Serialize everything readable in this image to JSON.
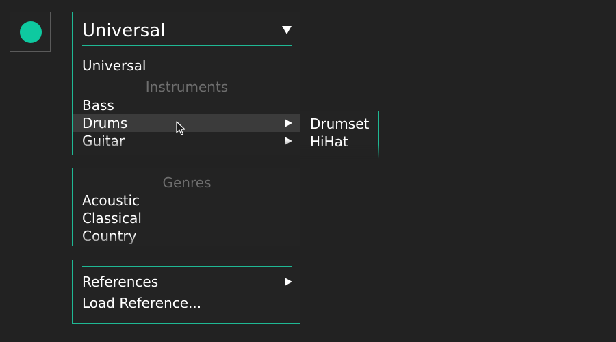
{
  "colors": {
    "background": "#222222",
    "accent": "#1fb894",
    "status_dot": "#0ec9a0",
    "section_label": "#6e6e6e",
    "highlight": "#3b3b3b"
  },
  "status": {
    "icon": "record-dot-icon"
  },
  "dropdown": {
    "selected": "Universal",
    "caret_icon": "triangle-down-icon",
    "items": {
      "universal": "Universal",
      "instruments_label": "Instruments",
      "bass": "Bass",
      "drums": "Drums",
      "guitar": "Guitar",
      "genres_label": "Genres",
      "acoustic": "Acoustic",
      "classical": "Classical",
      "country": "Country",
      "references": "References",
      "load_reference": "Load Reference..."
    },
    "highlighted_item": "Drums",
    "submenu_arrow_icon": "triangle-right-icon"
  },
  "submenu": {
    "items": [
      "Drumset",
      "HiHat"
    ]
  },
  "cursor": {
    "icon": "mouse-pointer-icon"
  }
}
